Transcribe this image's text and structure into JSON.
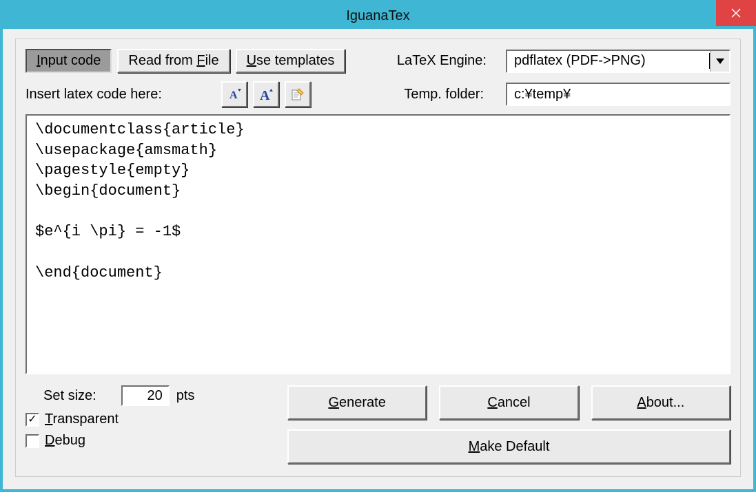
{
  "window": {
    "title": "IguanaTex"
  },
  "tabs": {
    "input_code": "Input code",
    "read_file": "Read from File",
    "templates": "Use templates"
  },
  "labels": {
    "engine": "LaTeX Engine:",
    "insert_code": "Insert latex code here:",
    "temp_folder": "Temp. folder:",
    "set_size": "Set size:",
    "pts": "pts",
    "transparent": "Transparent",
    "debug": "Debug"
  },
  "engine": {
    "value": "pdflatex (PDF->PNG)"
  },
  "temp_folder": {
    "value": "c:¥temp¥"
  },
  "code": "\\documentclass{article}\n\\usepackage{amsmath}\n\\pagestyle{empty}\n\\begin{document}\n\n$e^{i \\pi} = -1$\n\n\\end{document}",
  "size": {
    "value": "20"
  },
  "checks": {
    "transparent": true,
    "debug": false
  },
  "buttons": {
    "generate": "Generate",
    "cancel": "Cancel",
    "about": "About...",
    "make_default": "Make Default"
  },
  "icons": {
    "font_dec": "font-decrease-icon",
    "font_inc": "font-increase-icon",
    "wand": "format-icon"
  }
}
